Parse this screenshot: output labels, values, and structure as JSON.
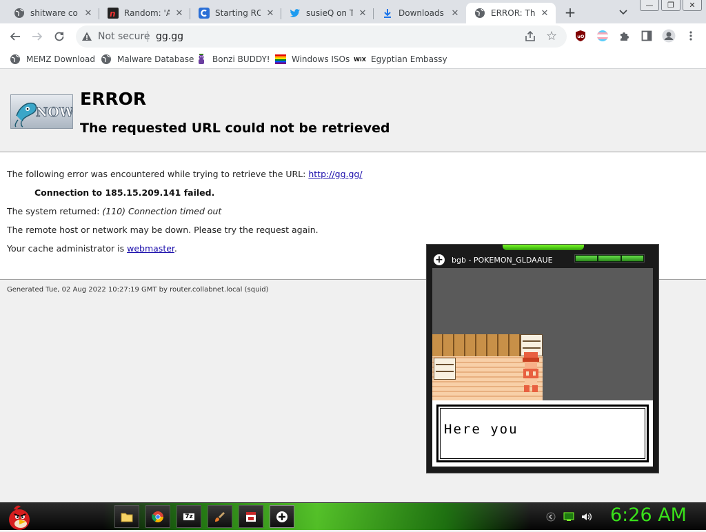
{
  "window": {
    "minimize": "—",
    "restore": "❐",
    "close": "✕"
  },
  "tabs": [
    {
      "title": "shitware coll",
      "icon": "globe-icon",
      "active": false
    },
    {
      "title": "Random: 'An",
      "icon": "n-logo-icon",
      "active": false
    },
    {
      "title": "Starting RON",
      "icon": "c-logo-icon",
      "active": false
    },
    {
      "title": "susieQ on Tw",
      "icon": "twitter-icon",
      "active": false
    },
    {
      "title": "Downloads",
      "icon": "download-icon",
      "active": false
    },
    {
      "title": "ERROR: The",
      "icon": "globe-icon",
      "active": true
    }
  ],
  "new_tab": "+",
  "address_bar": {
    "security": "Not secure",
    "url": "gg.gg"
  },
  "bookmarks": [
    {
      "label": "MEMZ Download",
      "icon": "globe-icon"
    },
    {
      "label": "Malware Database",
      "icon": "globe-icon"
    },
    {
      "label": "Bonzi BUDDY!",
      "icon": "bonzi-icon"
    },
    {
      "label": "Windows ISOs",
      "icon": "rainbow-flag-icon"
    },
    {
      "label": "Egyptian Embassy",
      "icon": "wix-icon",
      "icon_text": "WiX"
    }
  ],
  "page": {
    "logo_text": "NOW",
    "title": "ERROR",
    "subtitle": "The requested URL could not be retrieved",
    "line1_prefix": "The following error was encountered while trying to retrieve the URL: ",
    "line1_link": "http://gg.gg/",
    "connection": "Connection to 185.15.209.141 failed.",
    "system_prefix": "The system returned: ",
    "system_value": "(110) Connection timed out",
    "remote": "The remote host or network may be down. Please try the request again.",
    "cache_prefix": "Your cache administrator is ",
    "cache_link": "webmaster",
    "cache_suffix": ".",
    "footer": "Generated Tue, 02 Aug 2022 10:27:19 GMT by router.collabnet.local (squid)"
  },
  "emulator": {
    "title": "bgb - POKEMON_GLDAAUE",
    "dialog": "Here you"
  },
  "taskbar": {
    "clock": "6:26 AM",
    "zip_label": "7z"
  },
  "colors": {
    "clock": "#39e11a",
    "link": "#1a0dab",
    "taskbar_glow": "#5ad22a"
  }
}
